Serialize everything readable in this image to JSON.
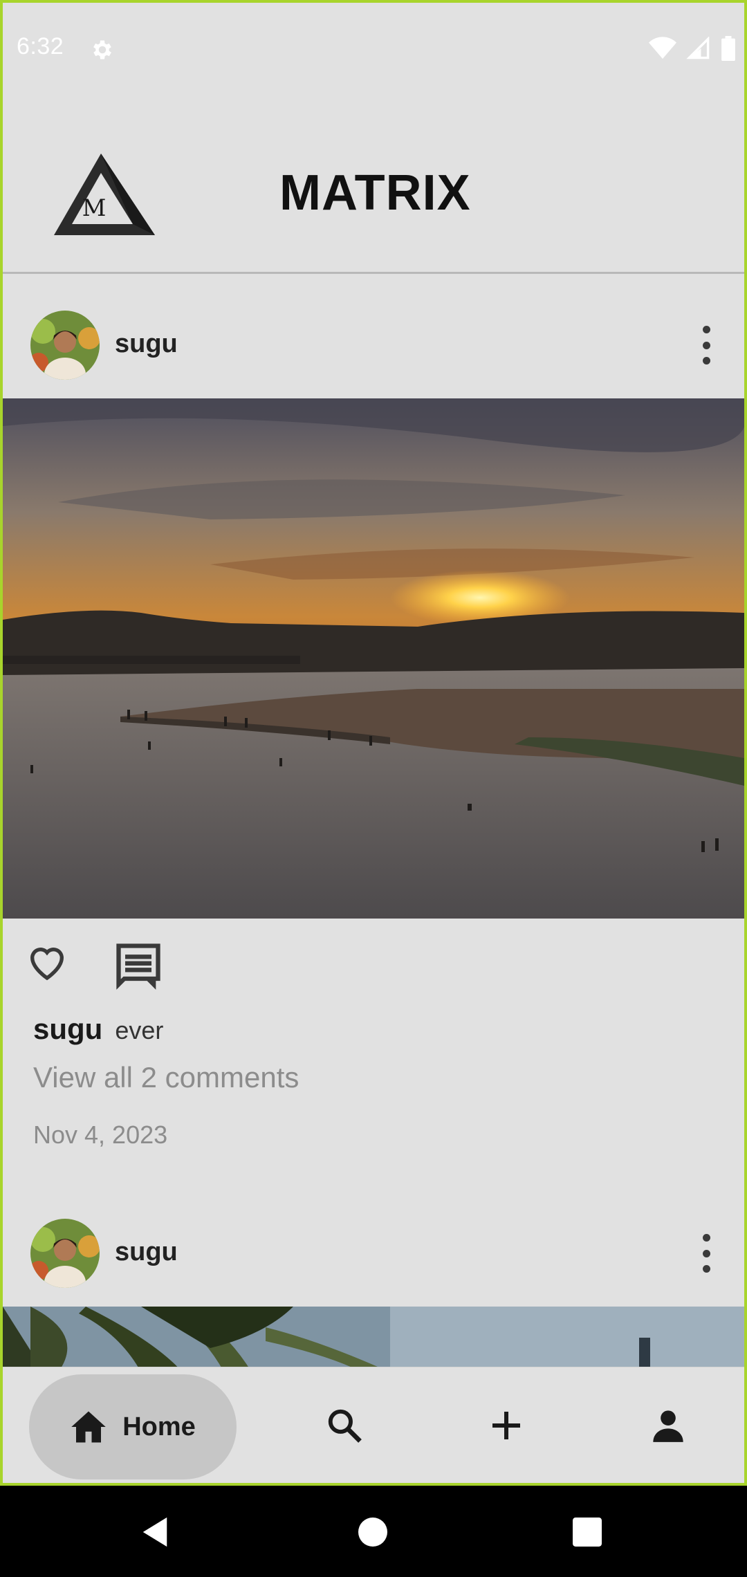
{
  "status_bar": {
    "time": "6:32"
  },
  "app_bar": {
    "logo_letter": "M",
    "title": "MATRIX"
  },
  "posts": [
    {
      "username": "sugu",
      "caption_user": "sugu",
      "caption_text": "ever",
      "view_comments": "View all 2 comments",
      "date": "Nov 4, 2023"
    },
    {
      "username": "sugu"
    }
  ],
  "bottom_nav": {
    "home_label": "Home",
    "items": [
      "home-icon",
      "search-icon",
      "add-icon",
      "profile-icon"
    ]
  },
  "colors": {
    "background": "#e1e1e1",
    "active_pill": "#c6c6c6",
    "accent_border": "#a8d42c"
  }
}
